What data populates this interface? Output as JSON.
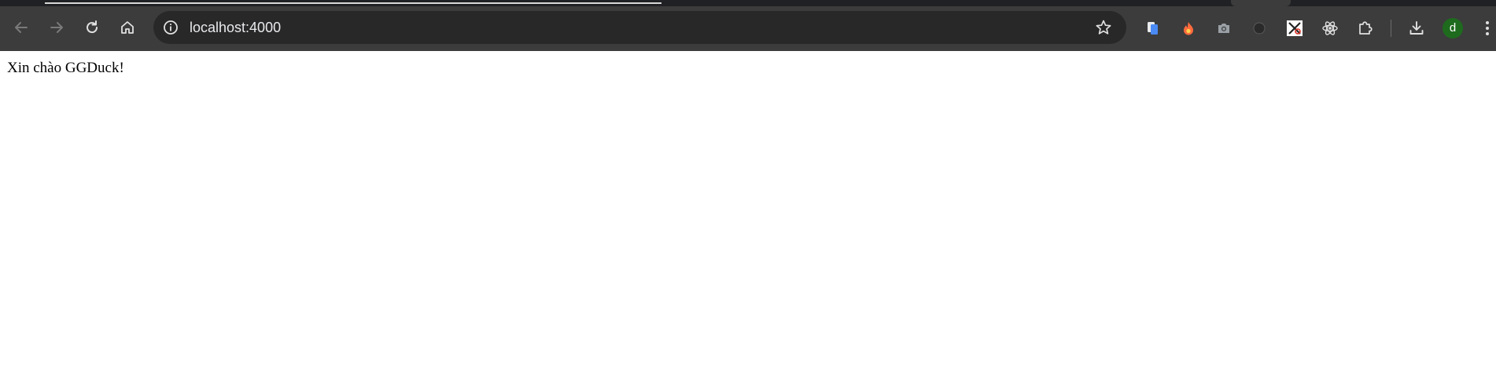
{
  "browser": {
    "address_bar": {
      "url": "localhost:4000"
    },
    "avatar_initial": "d",
    "colors": {
      "chrome_bg": "#3c3c3c",
      "omnibox_bg": "#282828",
      "avatar_bg": "#1e6b1e"
    },
    "toolbar_icons": [
      "back-arrow-icon",
      "forward-arrow-icon",
      "reload-icon",
      "home-icon",
      "site-info-icon",
      "bookmark-star-icon"
    ],
    "extension_icons": [
      "copy-extension-icon",
      "fire-extension-icon",
      "camera-extension-icon",
      "moon-extension-icon",
      "tools-extension-icon",
      "react-devtools-icon",
      "puzzle-extensions-icon",
      "download-icon",
      "chrome-menu-icon"
    ]
  },
  "page": {
    "text": "Xin chào GGDuck!"
  }
}
